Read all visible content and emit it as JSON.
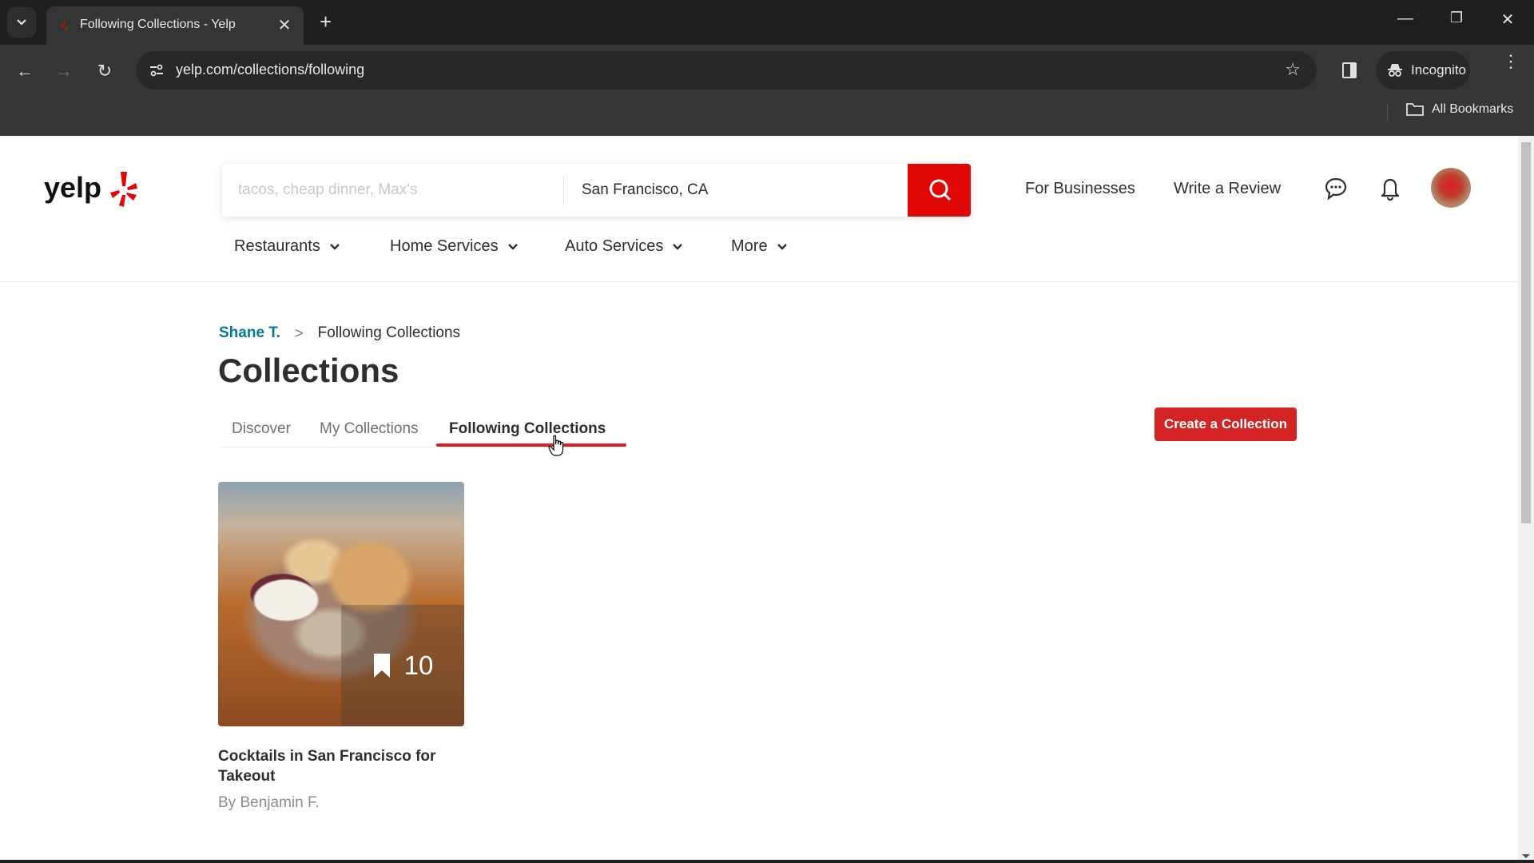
{
  "browser": {
    "tab_title": "Following Collections - Yelp",
    "url": "yelp.com/collections/following",
    "incognito_label": "Incognito",
    "bookmarks_label": "All Bookmarks",
    "icons": {
      "tab_list": "chevron-down-icon",
      "close_tab": "close-icon",
      "new_tab": "plus-icon",
      "minimize": "minimize-icon",
      "restore": "restore-icon",
      "close_window": "close-icon",
      "back": "back-arrow-icon",
      "forward": "forward-arrow-icon",
      "reload": "reload-icon",
      "site_info": "tune-icon",
      "bookmark_star": "star-icon",
      "side_panel": "side-panel-icon",
      "incognito": "incognito-icon",
      "menu": "kebab-menu-icon",
      "folder": "folder-icon"
    }
  },
  "header": {
    "logo_text": "yelp",
    "search": {
      "what_placeholder": "tacos, cheap dinner, Max's",
      "what_value": "",
      "where_value": "San Francisco, CA"
    },
    "links": {
      "for_businesses": "For Businesses",
      "write_review": "Write a Review"
    },
    "categories": [
      {
        "label": "Restaurants"
      },
      {
        "label": "Home Services"
      },
      {
        "label": "Auto Services"
      },
      {
        "label": "More"
      }
    ]
  },
  "breadcrumb": {
    "user": "Shane T.",
    "separator": ">",
    "current": "Following Collections"
  },
  "page": {
    "title": "Collections",
    "tabs": [
      {
        "label": "Discover",
        "active": false
      },
      {
        "label": "My Collections",
        "active": false
      },
      {
        "label": "Following Collections",
        "active": true
      }
    ],
    "create_button": "Create a Collection"
  },
  "collections": [
    {
      "title": "Cocktails in San Francisco for Takeout",
      "author": "By Benjamin F.",
      "saved_count": "10"
    }
  ],
  "colors": {
    "brand_red": "#d32323",
    "search_red": "#e00707",
    "link_blue": "#027a97",
    "text_dark": "#2d2e2f"
  }
}
